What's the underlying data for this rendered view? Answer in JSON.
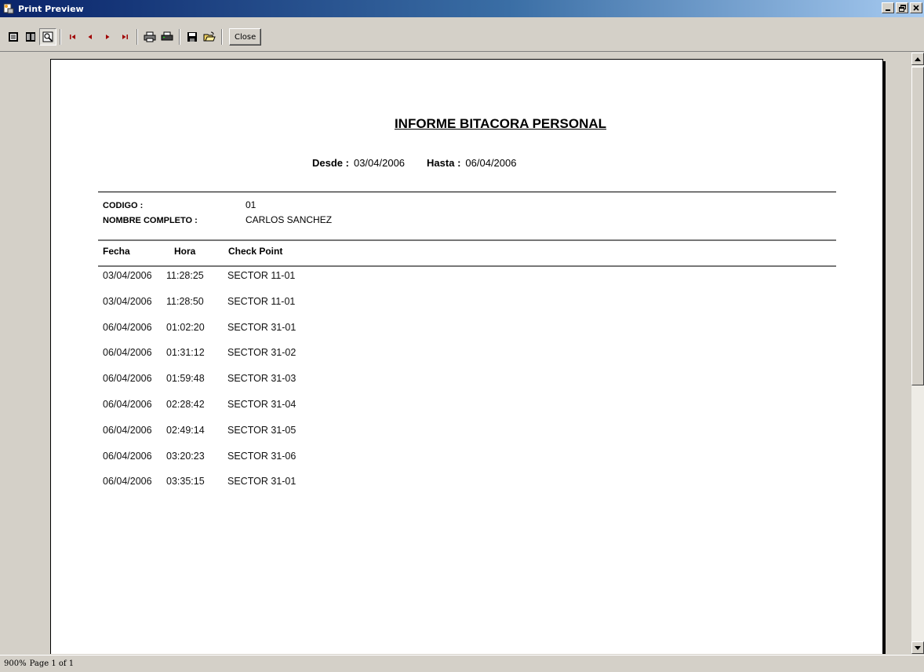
{
  "window": {
    "title": "Print Preview",
    "minimize_icon": "minimize-icon",
    "maximize_icon": "restore-icon",
    "close_icon": "close-icon"
  },
  "toolbar": {
    "buttons": [
      {
        "name": "one-page-icon"
      },
      {
        "name": "two-pages-icon"
      },
      {
        "name": "zoom-icon",
        "pressed": true
      },
      {
        "name": "first-page-icon"
      },
      {
        "name": "previous-page-icon"
      },
      {
        "name": "next-page-icon"
      },
      {
        "name": "last-page-icon"
      },
      {
        "name": "print-icon"
      },
      {
        "name": "print-setup-icon"
      },
      {
        "name": "save-icon"
      },
      {
        "name": "open-icon"
      }
    ],
    "close_label": "Close"
  },
  "report": {
    "title": "INFORME BITACORA PERSONAL",
    "desde_label": "Desde :",
    "desde_value": "03/04/2006",
    "hasta_label": "Hasta :",
    "hasta_value": "06/04/2006",
    "codigo_label": "CODIGO :",
    "codigo_value": "01",
    "nombre_label": "NOMBRE COMPLETO :",
    "nombre_value": "CARLOS SANCHEZ",
    "columns": [
      "Fecha",
      "Hora",
      "Check Point"
    ],
    "rows": [
      {
        "fecha": "03/04/2006",
        "hora": "11:28:25",
        "checkpoint": "SECTOR 11-01"
      },
      {
        "fecha": "03/04/2006",
        "hora": "11:28:50",
        "checkpoint": "SECTOR 11-01"
      },
      {
        "fecha": "06/04/2006",
        "hora": "01:02:20",
        "checkpoint": "SECTOR 31-01"
      },
      {
        "fecha": "06/04/2006",
        "hora": "01:31:12",
        "checkpoint": "SECTOR 31-02"
      },
      {
        "fecha": "06/04/2006",
        "hora": "01:59:48",
        "checkpoint": "SECTOR 31-03"
      },
      {
        "fecha": "06/04/2006",
        "hora": "02:28:42",
        "checkpoint": "SECTOR 31-04"
      },
      {
        "fecha": "06/04/2006",
        "hora": "02:49:14",
        "checkpoint": "SECTOR 31-05"
      },
      {
        "fecha": "06/04/2006",
        "hora": "03:20:23",
        "checkpoint": "SECTOR 31-06"
      },
      {
        "fecha": "06/04/2006",
        "hora": "03:35:15",
        "checkpoint": "SECTOR 31-01"
      }
    ]
  },
  "status": {
    "zoom": "900%",
    "page": "Page 1 of 1"
  },
  "colors": {
    "titlebar_start": "#0a246a",
    "titlebar_end": "#a6caf0",
    "chrome": "#d4d0c8"
  }
}
